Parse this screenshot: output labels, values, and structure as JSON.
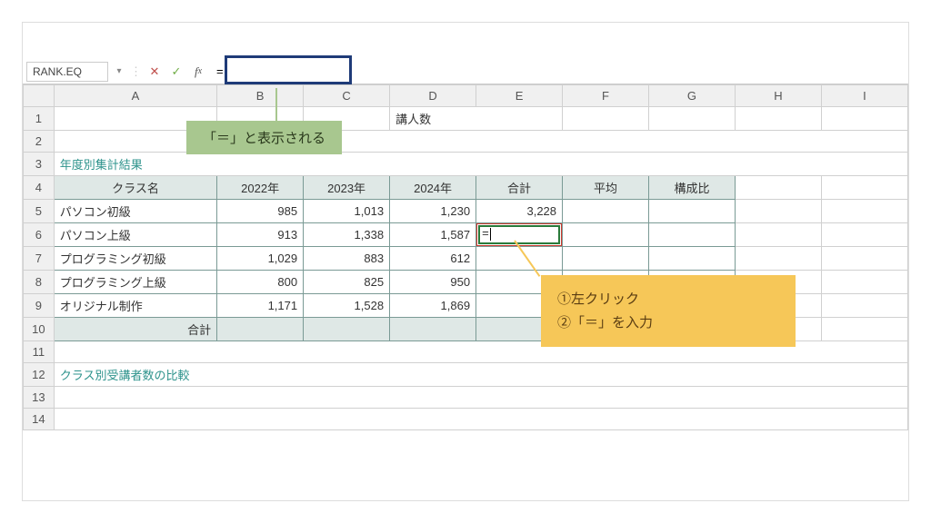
{
  "formula_bar": {
    "name_box": "RANK.EQ",
    "input_value": "="
  },
  "columns": [
    "A",
    "B",
    "C",
    "D",
    "E",
    "F",
    "G",
    "H",
    "I"
  ],
  "rows_count": 14,
  "title_fragment": "講人数",
  "section1_label": "年度別集計結果",
  "section2_label": "クラス別受講者数の比較",
  "headers": {
    "class": "クラス名",
    "y2022": "2022年",
    "y2023": "2023年",
    "y2024": "2024年",
    "total": "合計",
    "avg": "平均",
    "ratio": "構成比"
  },
  "rows": [
    {
      "class": "パソコン初級",
      "y2022": "985",
      "y2023": "1,013",
      "y2024": "1,230",
      "total": "3,228"
    },
    {
      "class": "パソコン上級",
      "y2022": "913",
      "y2023": "1,338",
      "y2024": "1,587",
      "total": "="
    },
    {
      "class": "プログラミング初級",
      "y2022": "1,029",
      "y2023": "883",
      "y2024": "612",
      "total": ""
    },
    {
      "class": "プログラミング上級",
      "y2022": "800",
      "y2023": "825",
      "y2024": "950",
      "total": ""
    },
    {
      "class": "オリジナル制作",
      "y2022": "1,171",
      "y2023": "1,528",
      "y2024": "1,869",
      "total": ""
    }
  ],
  "total_label": "合計",
  "callout_green": "「＝」と表示される",
  "callout_yellow_line1": "①左クリック",
  "callout_yellow_line2": "②「＝」を入力",
  "active_cell": "E6"
}
